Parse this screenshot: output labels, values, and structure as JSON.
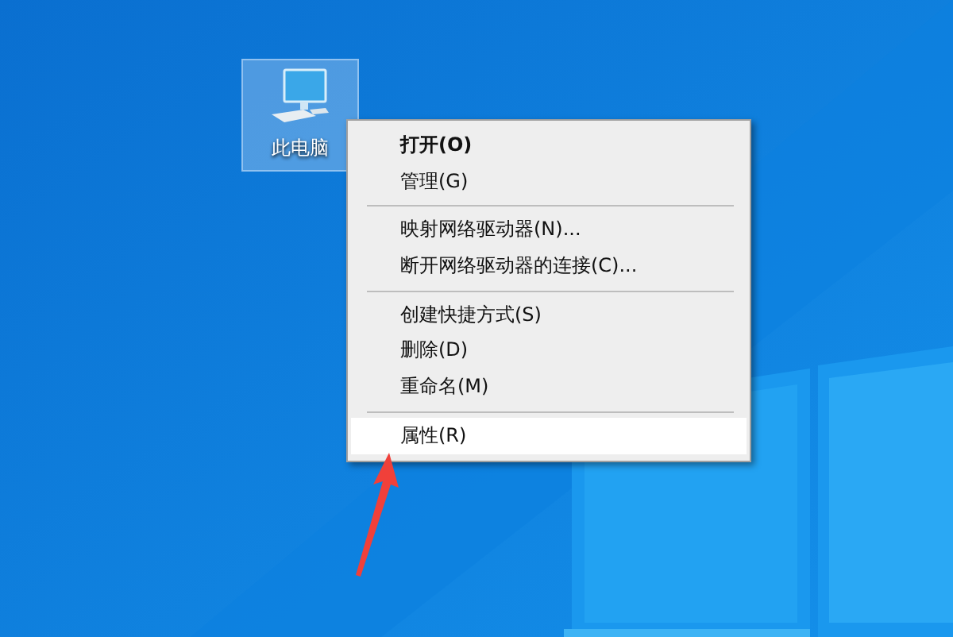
{
  "desktop_icons": [
    {
      "label": "此电脑",
      "selected": true
    }
  ],
  "context_menu": {
    "items": [
      {
        "kind": "item",
        "label": "打开(O)",
        "default": true,
        "selected": false
      },
      {
        "kind": "item",
        "label": "管理(G)",
        "default": false,
        "selected": false
      },
      {
        "kind": "separator"
      },
      {
        "kind": "item",
        "label": "映射网络驱动器(N)...",
        "default": false,
        "selected": false
      },
      {
        "kind": "item",
        "label": "断开网络驱动器的连接(C)...",
        "default": false,
        "selected": false
      },
      {
        "kind": "separator"
      },
      {
        "kind": "item",
        "label": "创建快捷方式(S)",
        "default": false,
        "selected": false
      },
      {
        "kind": "item",
        "label": "删除(D)",
        "default": false,
        "selected": false
      },
      {
        "kind": "item",
        "label": "重命名(M)",
        "default": false,
        "selected": false
      },
      {
        "kind": "separator"
      },
      {
        "kind": "item",
        "label": "属性(R)",
        "default": false,
        "selected": true
      }
    ]
  }
}
